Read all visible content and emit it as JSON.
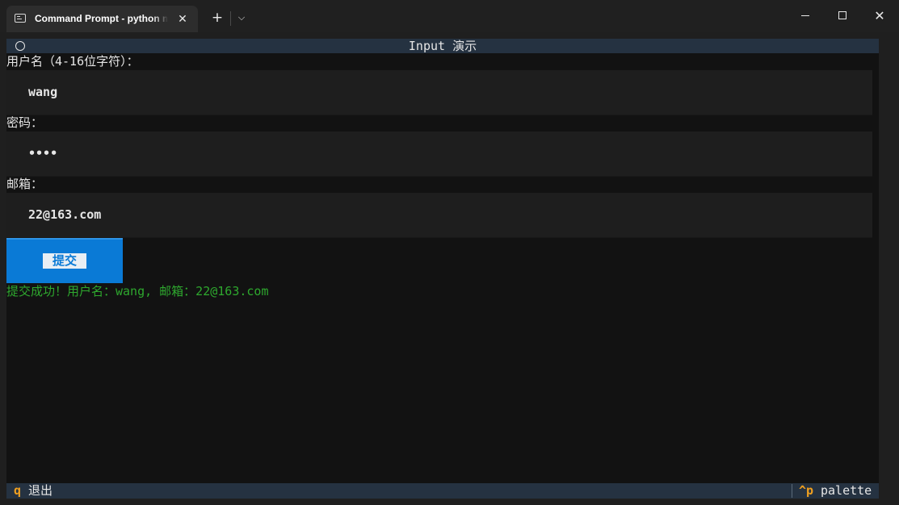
{
  "window": {
    "tab_title": "Command Prompt - python main.py",
    "tab_close_glyph": "✕",
    "new_tab_glyph": "+",
    "dropdown_glyph": "⌵",
    "close_glyph": "✕"
  },
  "app": {
    "title": "Input 演示"
  },
  "form": {
    "username": {
      "label": "用户名（4-16位字符）：",
      "value": "wang"
    },
    "password": {
      "label": "密码：",
      "value": "••••"
    },
    "email": {
      "label": "邮箱：",
      "value": "22@163.com"
    },
    "submit_label": "提交",
    "result": "提交成功！用户名：wang, 邮箱：22@163.com"
  },
  "footer": {
    "quit_key": "q",
    "quit_label": "退出",
    "palette_key": "^p",
    "palette_label": "palette"
  },
  "colors": {
    "header_bg": "#253241",
    "button_bg": "#0a7ad6",
    "success_text": "#2ea82e",
    "key_accent": "#f0a020"
  }
}
